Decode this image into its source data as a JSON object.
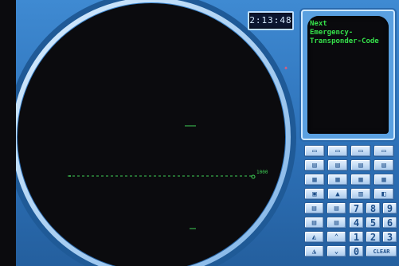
{
  "clock": {
    "time": "2:13:48"
  },
  "message": {
    "lines": [
      "Next",
      "Emergency-",
      "Transponder-Code"
    ]
  },
  "radar": {
    "range_label": "1000"
  },
  "keypad": {
    "rows": [
      [
        {
          "icon": "mode-1-key-icon"
        },
        {
          "icon": "mode-2-key-icon"
        },
        {
          "icon": "mode-3-key-icon"
        },
        {
          "icon": "mode-4-key-icon"
        }
      ],
      [
        {
          "icon": "func-1-key-icon"
        },
        {
          "icon": "func-2-key-icon"
        },
        {
          "icon": "func-3-key-icon"
        },
        {
          "icon": "func-4-key-icon"
        }
      ],
      [
        {
          "icon": "nav-1-key-icon"
        },
        {
          "icon": "nav-2-key-icon"
        },
        {
          "icon": "nav-3-key-icon"
        },
        {
          "icon": "nav-4-key-icon"
        }
      ],
      [
        {
          "icon": "sel-key-icon"
        },
        {
          "icon": "up-triangle-key-icon"
        },
        {
          "icon": "menu-key-icon"
        },
        {
          "icon": "exit-key-icon"
        }
      ],
      [
        {
          "icon": "com-key-icon"
        },
        {
          "icon": "rad-key-icon"
        },
        {
          "label": "7"
        },
        {
          "label": "8"
        },
        {
          "label": "9"
        }
      ],
      [
        {
          "icon": "alt-key-icon"
        },
        {
          "icon": "hdg-key-icon"
        },
        {
          "label": "4"
        },
        {
          "label": "5"
        },
        {
          "label": "6"
        }
      ],
      [
        {
          "icon": "page-up-key-icon"
        },
        {
          "icon": "scroll-up-key-icon"
        },
        {
          "label": "1"
        },
        {
          "label": "2"
        },
        {
          "label": "3"
        }
      ],
      [
        {
          "icon": "page-down-key-icon"
        },
        {
          "icon": "scroll-down-key-icon"
        },
        {
          "label": "0"
        },
        {
          "label": "CLEAR"
        }
      ]
    ]
  },
  "colors": {
    "console_blue": "#2f76bf",
    "screen_black": "#0a0a0d",
    "phosphor_green": "#35e04a",
    "key_face": "#cfe2f7"
  }
}
